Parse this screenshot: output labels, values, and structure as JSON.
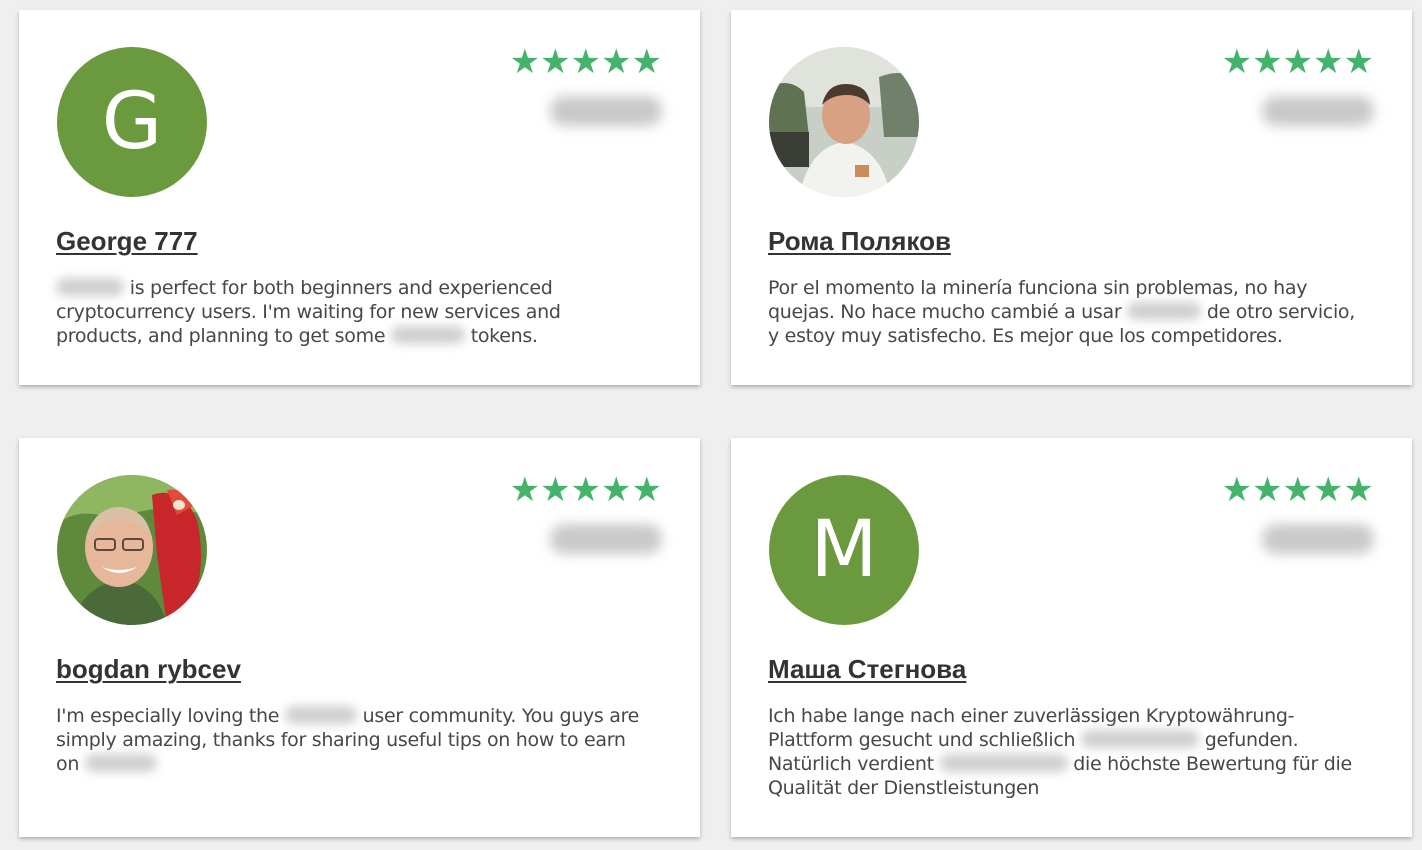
{
  "colors": {
    "page_background": "#efefef",
    "card_background": "#ffffff",
    "star_color": "#45b36b",
    "avatar_green": "#6b9a3e",
    "text_color": "#474747",
    "name_color": "#333333"
  },
  "reviews": [
    {
      "name": "George 777",
      "avatar_letter": "G",
      "rating": 5,
      "stars": "★★★★★",
      "lines": [
        {
          "before": "",
          "after": " is perfect for both beginners and experienced",
          "blur": true
        },
        {
          "before": "cryptocurrency users. I'm waiting for new services and",
          "after": "",
          "blur": false
        },
        {
          "before": "products, and planning to get some ",
          "after": " tokens.",
          "blur": true
        }
      ]
    },
    {
      "name": "Рома Поляков",
      "avatar_icon": "user-photo-icon",
      "rating": 5,
      "stars": "★★★★★",
      "lines": [
        {
          "before": "Por el momento la minería funciona sin problemas, no hay",
          "after": "",
          "blur": false
        },
        {
          "before": "quejas. No hace mucho cambié a usar ",
          "after": " de otro servicio,",
          "blur": true
        },
        {
          "before": "y estoy muy satisfecho. Es mejor que los competidores.",
          "after": "",
          "blur": false
        }
      ]
    },
    {
      "name": "bogdan rybcev",
      "avatar_icon": "user-photo-icon",
      "rating": 5,
      "stars": "★★★★★",
      "lines": [
        {
          "before": "I'm especially loving the ",
          "after": " user community. You guys are",
          "blur": true
        },
        {
          "before": "simply amazing, thanks for sharing useful tips on how to earn",
          "after": "",
          "blur": false
        },
        {
          "before": "on ",
          "after": "",
          "blur": true
        }
      ]
    },
    {
      "name": "Маша Стегнова",
      "avatar_letter": "M",
      "rating": 5,
      "stars": "★★★★★",
      "lines": [
        {
          "before": "Ich habe lange nach einer zuverlässigen Kryptowährung-",
          "after": "",
          "blur": false
        },
        {
          "before": "Plattform gesucht und schließlich ",
          "after": " gefunden.",
          "blur": true
        },
        {
          "before": "Natürlich verdient ",
          "after": " die höchste Bewertung für die",
          "blur": true
        },
        {
          "before": "Qualität der Dienstleistungen",
          "after": "",
          "blur": false
        }
      ]
    }
  ]
}
